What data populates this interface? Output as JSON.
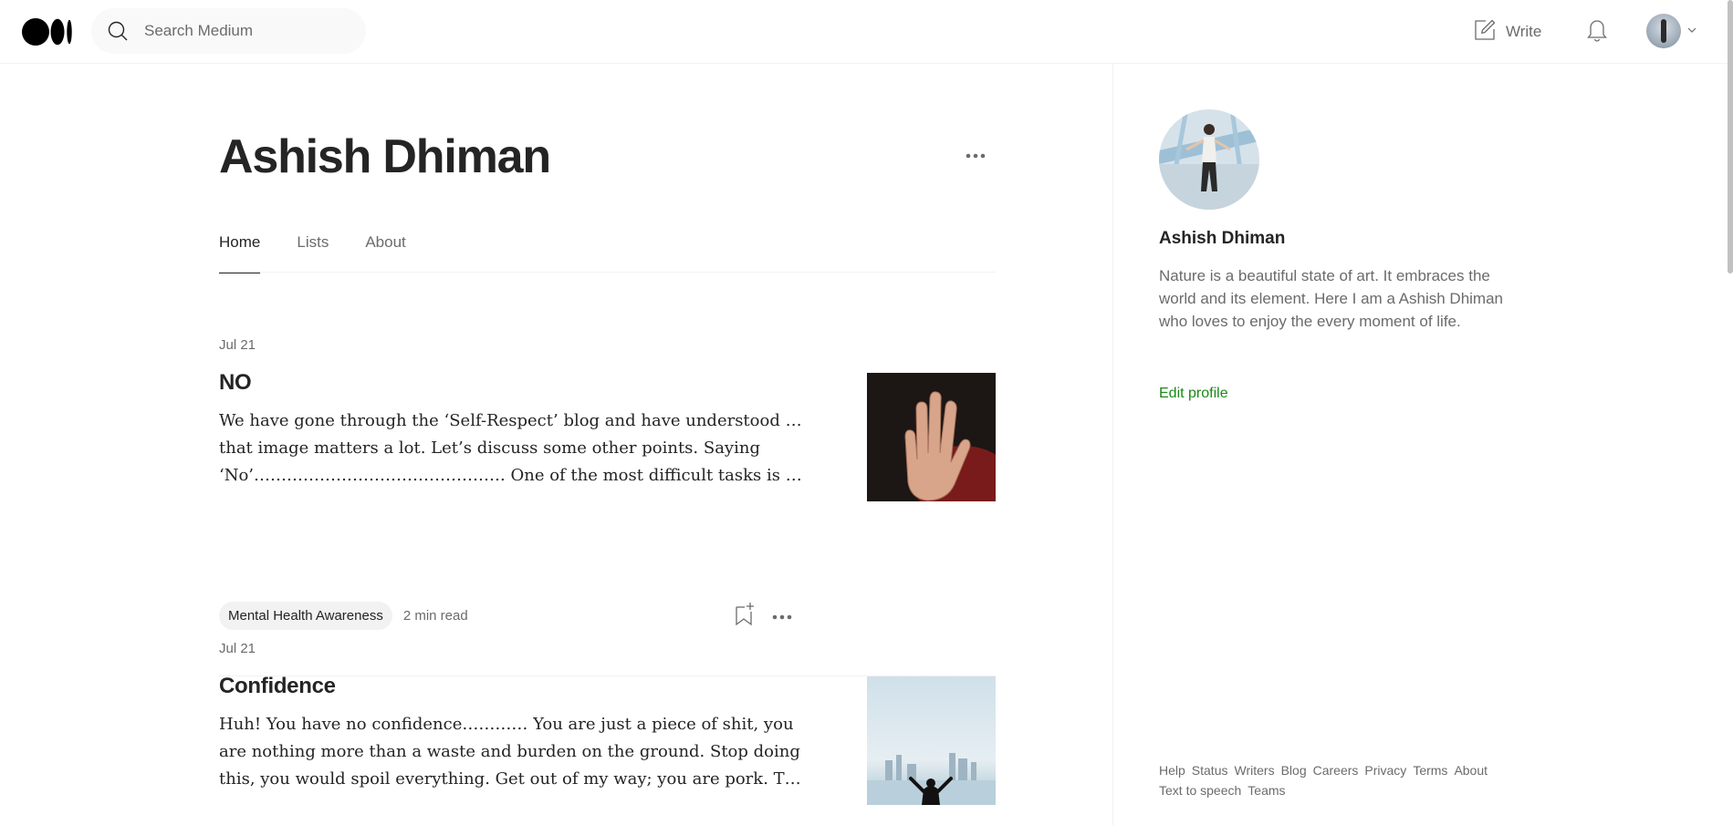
{
  "search": {
    "placeholder": "Search Medium"
  },
  "header": {
    "write_label": "Write"
  },
  "profile": {
    "name": "Ashish Dhiman",
    "tabs": [
      {
        "label": "Home",
        "active": true
      },
      {
        "label": "Lists",
        "active": false
      },
      {
        "label": "About",
        "active": false
      }
    ]
  },
  "articles": [
    {
      "date": "Jul 21",
      "title": "NO",
      "excerpt_lines": [
        "We have gone through the ‘Self-Respect’ blog and have understood well",
        "that image matters a lot. Let’s discuss some other points. Saying",
        "‘No’………………………………………. One of the most difficult tasks is t…"
      ],
      "tag": "Mental Health Awareness",
      "read_time": "2 min read",
      "thumb_icon": "raised-hand-image"
    },
    {
      "date": "Jul 21",
      "title": "Confidence",
      "excerpt_lines": [
        "Huh! You have no confidence………… You are just a piece of shit, you",
        "are nothing more than a waste and burden on the ground. Stop doing",
        "this, you would spoil everything. Get out of my way; you are pork. Thi…"
      ],
      "thumb_icon": "city-skyline-image"
    }
  ],
  "sidebar": {
    "name": "Ashish Dhiman",
    "bio": "Nature is a beautiful state of art. It embraces the world and its element. Here I am a Ashish Dhiman who loves to enjoy the every moment of life.",
    "edit_profile": "Edit profile",
    "footer_links": [
      "Help",
      "Status",
      "Writers",
      "Blog",
      "Careers",
      "Privacy",
      "Terms",
      "About",
      "Text to speech",
      "Teams"
    ]
  },
  "colors": {
    "accent_green": "#1a8917",
    "text": "#242424",
    "muted": "#6b6b6b"
  }
}
